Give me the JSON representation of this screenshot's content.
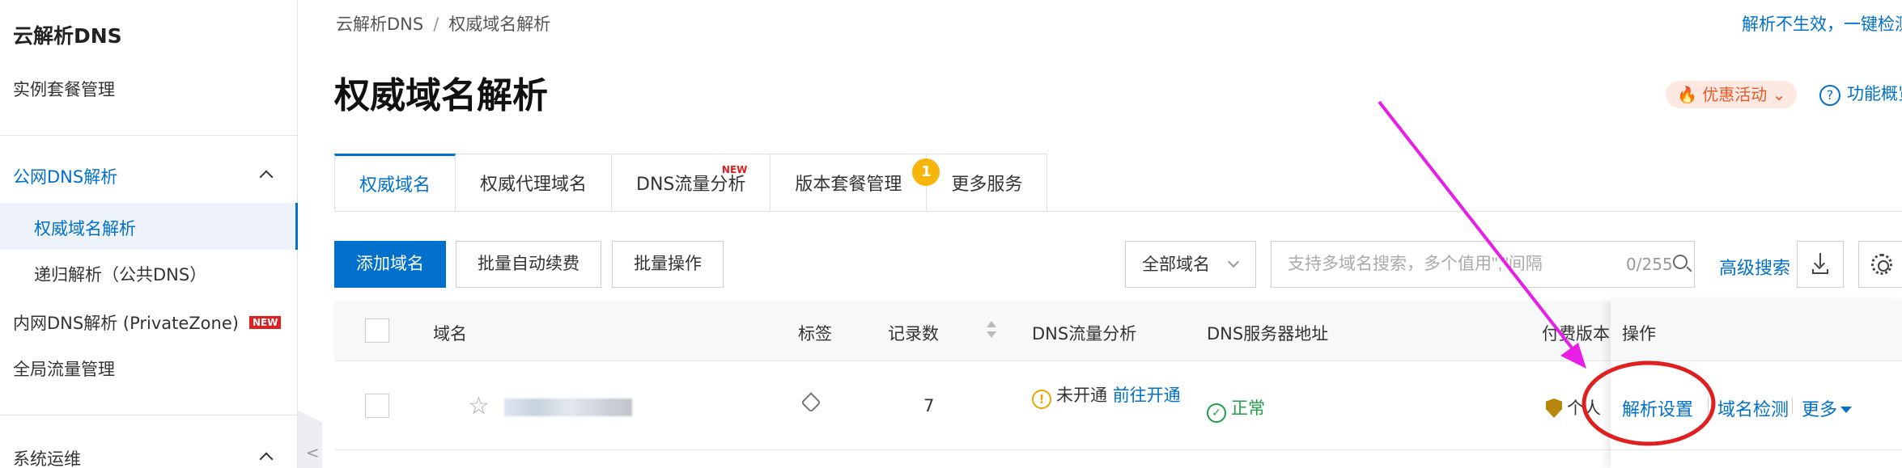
{
  "sidebar": {
    "title": "云解析DNS",
    "items": [
      {
        "label": "实例套餐管理"
      },
      {
        "label": "公网DNS解析"
      },
      {
        "label": "权威域名解析"
      },
      {
        "label": "递归解析（公共DNS）"
      },
      {
        "label": "内网DNS解析 (PrivateZone)"
      },
      {
        "label": "全局流量管理"
      },
      {
        "label": "系统运维"
      }
    ],
    "new_tag": "NEW",
    "collapse_glyph": "<"
  },
  "breadcrumb": {
    "root": "云解析DNS",
    "separator": "/",
    "current": "权威域名解析"
  },
  "header": {
    "top_right_link": "解析不生效，一键检测",
    "title": "权威域名解析",
    "promo_label": "优惠活动",
    "help_label": "功能概览"
  },
  "tabs": [
    {
      "label": "权威域名"
    },
    {
      "label": "权威代理域名"
    },
    {
      "label": "DNS流量分析",
      "tag": "NEW"
    },
    {
      "label": "版本套餐管理",
      "badge": "1"
    },
    {
      "label": "更多服务"
    }
  ],
  "toolbar": {
    "add_domain": "添加域名",
    "batch_renew": "批量自动续费",
    "batch_ops": "批量操作",
    "domain_filter": "全部域名",
    "search_placeholder": "支持多域名搜索，多个值用\",\"间隔",
    "search_count": "0/255",
    "advanced_search": "高级搜索"
  },
  "table": {
    "columns": {
      "domain": "域名",
      "tag": "标签",
      "records": "记录数",
      "traffic": "DNS流量分析",
      "dns_server": "DNS服务器地址",
      "edition": "付费版本",
      "actions": "操作"
    },
    "rows": [
      {
        "records": "7",
        "traffic_status": "未开通",
        "traffic_link": "前往开通",
        "dns_status": "正常",
        "edition": "个人",
        "action_settings": "解析设置",
        "action_check": "域名检测",
        "action_more": "更多"
      }
    ]
  },
  "colors": {
    "accent": "#0070cc",
    "ok": "#1f9e4a",
    "warn": "#e6a700",
    "new_tag": "#e02020",
    "annotation_arrow": "#e61ee6",
    "annotation_circle": "#e02020"
  }
}
